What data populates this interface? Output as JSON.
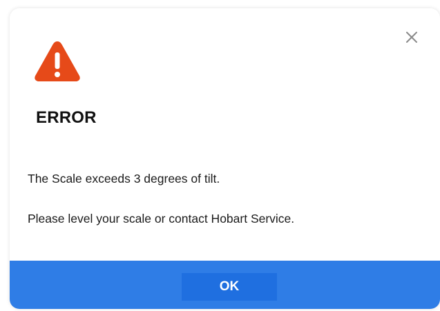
{
  "dialog": {
    "title": "ERROR",
    "messages": [
      "The Scale exceeds 3 degrees of tilt.",
      "Please level your scale or contact Hobart Service."
    ],
    "ok_label": "OK",
    "close_icon": "close-icon",
    "status_icon": "warning-triangle-icon"
  },
  "colors": {
    "warning": "#e64a19",
    "accent": "#2f7de6",
    "button": "#1f6fe0",
    "text": "#111111"
  }
}
